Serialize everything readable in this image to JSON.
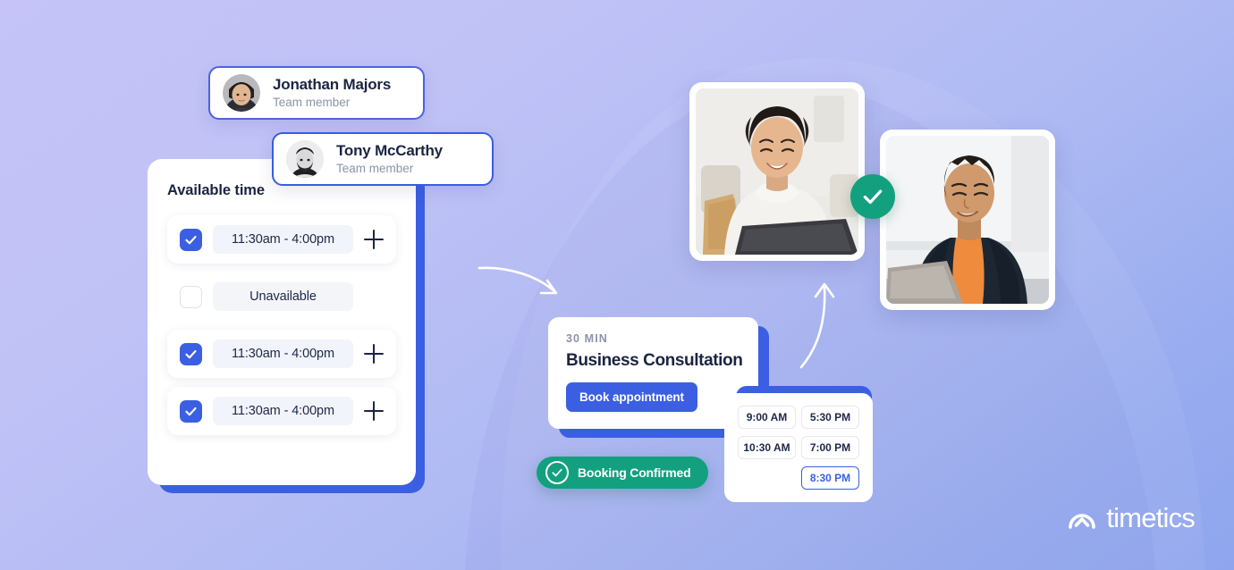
{
  "theme": {
    "bg_from": "#c5c3f8",
    "bg_to": "#8fa6ee",
    "accent_blue": "#3b5fe2",
    "accent_green": "#13a07e",
    "text_dark": "#1b2442",
    "text_muted": "#8b93a7",
    "chip_bg": "#f2f4fb"
  },
  "members": [
    {
      "name": "Jonathan Majors",
      "role": "Team member",
      "avatar_icon": "avatar-jonathan"
    },
    {
      "name": "Tony McCarthy",
      "role": "Team member",
      "avatar_icon": "avatar-tony"
    }
  ],
  "availability": {
    "title": "Available time",
    "slots": [
      {
        "checked": true,
        "label": "11:30am - 4:00pm",
        "has_add": true
      },
      {
        "checked": false,
        "label": "Unavailable",
        "has_add": false
      },
      {
        "checked": true,
        "label": "11:30am - 4:00pm",
        "has_add": true
      },
      {
        "checked": true,
        "label": "11:30am - 4:00pm",
        "has_add": true
      }
    ],
    "add_icon": "plus-icon",
    "check_icon": "check-icon"
  },
  "consultation": {
    "duration": "30 MIN",
    "title": "Business Consultation",
    "book_label": "Book appointment"
  },
  "time_picker": {
    "slots": [
      {
        "label": "9:00 AM",
        "selected": false
      },
      {
        "label": "5:30 PM",
        "selected": false
      },
      {
        "label": "10:30 AM",
        "selected": false
      },
      {
        "label": "7:00 PM",
        "selected": false
      },
      {
        "label": "",
        "selected": false,
        "blank": true
      },
      {
        "label": "8:30 PM",
        "selected": true
      }
    ]
  },
  "confirmation": {
    "label": "Booking Confirmed",
    "icon": "check-circle-icon"
  },
  "photos": [
    {
      "name": "photo-woman-on-laptop",
      "alt": "Smiling woman working on a laptop"
    },
    {
      "name": "photo-man-on-laptop",
      "alt": "Smiling man working on a laptop"
    }
  ],
  "status_badge": {
    "icon": "check-icon"
  },
  "brand": {
    "name": "timetics",
    "mark": "timetics-logo-icon"
  }
}
